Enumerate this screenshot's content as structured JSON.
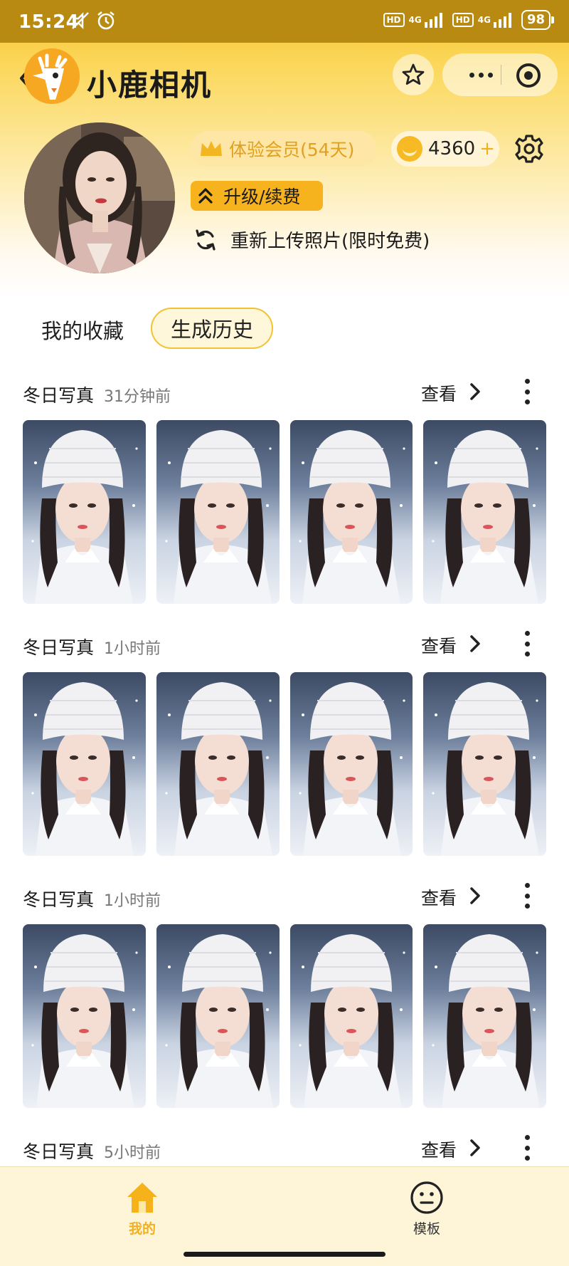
{
  "status_bar": {
    "time": "15:24",
    "hd1": "HD",
    "net1": "4G",
    "hd2": "HD",
    "net2": "4G",
    "battery": "98"
  },
  "header": {
    "title": "小鹿相机"
  },
  "profile": {
    "member_badge": "体验会员(54天)",
    "coins": "4360",
    "coins_plus": "+",
    "upgrade_label": "升级/续费",
    "reupload_label": "重新上传照片(限时免费)"
  },
  "tabs": {
    "favorites": "我的收藏",
    "history": "生成历史"
  },
  "history": [
    {
      "title": "冬日写真",
      "time": "31分钟前",
      "view": "查看"
    },
    {
      "title": "冬日写真",
      "time": "1小时前",
      "view": "查看"
    },
    {
      "title": "冬日写真",
      "time": "1小时前",
      "view": "查看"
    },
    {
      "title": "冬日写真",
      "time": "5小时前",
      "view": "查看"
    }
  ],
  "bottom_nav": {
    "me": "我的",
    "templates": "模板"
  },
  "colors": {
    "accent": "#f7b31e",
    "header_bg": "#f6c22e"
  },
  "icons": [
    "back-icon",
    "deer-logo-icon",
    "star-icon",
    "more-icon",
    "target-icon",
    "crown-icon",
    "coin-icon",
    "gear-icon",
    "double-chevron-up-icon",
    "refresh-icon",
    "chevron-right-icon",
    "vertical-more-icon",
    "home-icon",
    "face-icon"
  ]
}
